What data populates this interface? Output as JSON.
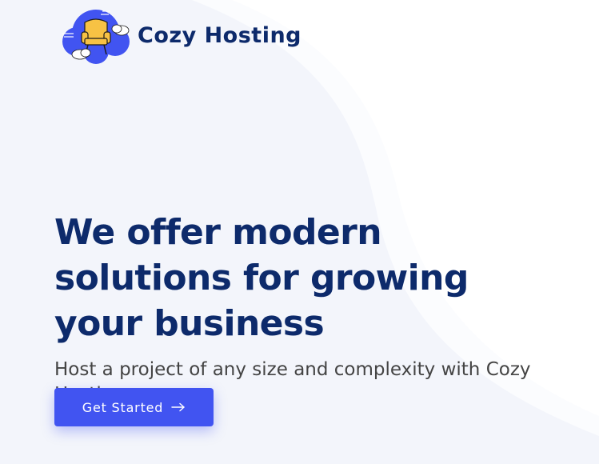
{
  "brand": {
    "name": "Cozy Hosting",
    "logo_icon": "cloud-armchair-logo-icon"
  },
  "hero": {
    "title": "We offer modern solutions for growing your business",
    "subtitle": "Host a project of any size and complexity with Cozy Hosting"
  },
  "cta": {
    "label": "Get Started",
    "icon": "arrow-right-icon"
  },
  "colors": {
    "accent": "#4154f1",
    "heading": "#0d2a6b",
    "body_text": "#444444",
    "background": "#f3f5fb",
    "background_wave": "#ffffff"
  }
}
